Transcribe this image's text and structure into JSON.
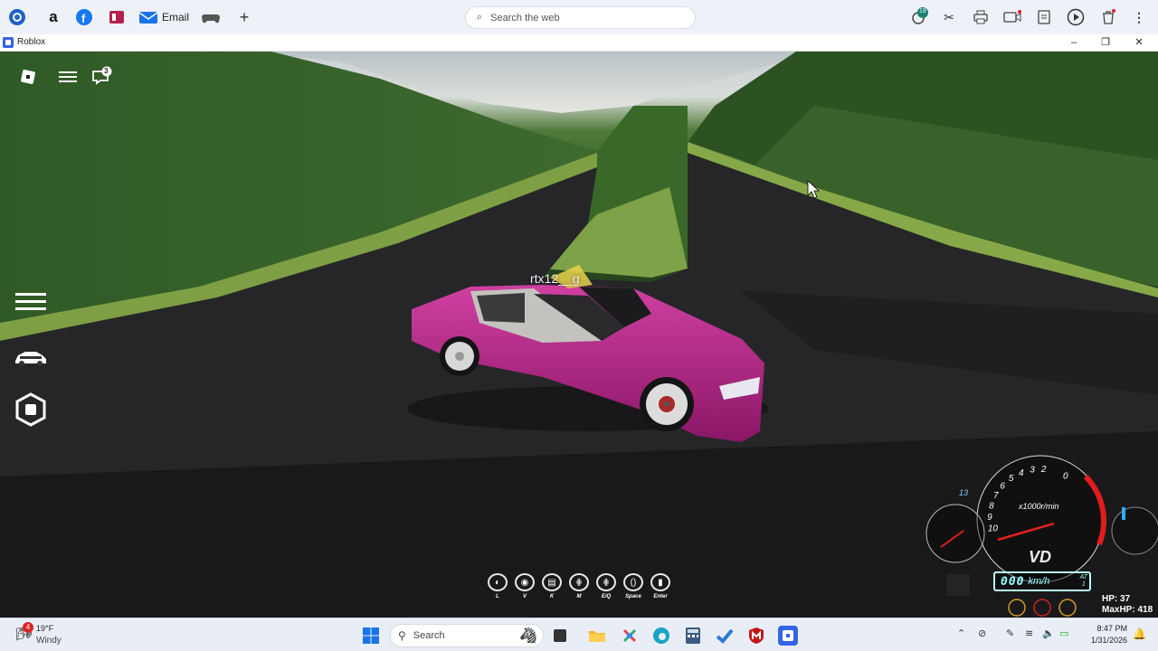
{
  "browser_bar": {
    "email_label": "Email",
    "search_placeholder": "Search the web",
    "notification_count": "19"
  },
  "window": {
    "title": "Roblox"
  },
  "game": {
    "chat_badge": "3",
    "player_name": "rtx12__g",
    "controls": [
      {
        "key": "L",
        "icon": "headlight-icon"
      },
      {
        "key": "V",
        "icon": "camera-icon"
      },
      {
        "key": "K",
        "icon": "engine-icon"
      },
      {
        "key": "M",
        "icon": "manual-shift-icon"
      },
      {
        "key": "E/Q",
        "icon": "gear-shift-icon"
      },
      {
        "key": "Space",
        "icon": "handbrake-icon"
      },
      {
        "key": "Enter",
        "icon": "exit-icon"
      }
    ],
    "gauge": {
      "rpm_unit": "x1000r/min",
      "rpm_ticks": [
        "0",
        "2",
        "3",
        "4",
        "5",
        "6",
        "7",
        "8",
        "9",
        "10"
      ],
      "gear_small": "13",
      "brand": "VD",
      "speed_unit": "km/h",
      "speed_digits": "000",
      "transmission_top": "AT",
      "transmission_bottom": "1",
      "hp_label": "HP: 37",
      "maxhp_label": "MaxHP: 418"
    }
  },
  "taskbar": {
    "weather_temp": "19°F",
    "weather_cond": "Windy",
    "weather_badge": "4",
    "search_label": "Search",
    "time": "8:47 PM",
    "date": "1/31/2026"
  },
  "colors": {
    "car": "#b0207f",
    "road": "#2a2a2d",
    "foliage": "#2f5a26",
    "taskbar": "#e9eef6"
  }
}
